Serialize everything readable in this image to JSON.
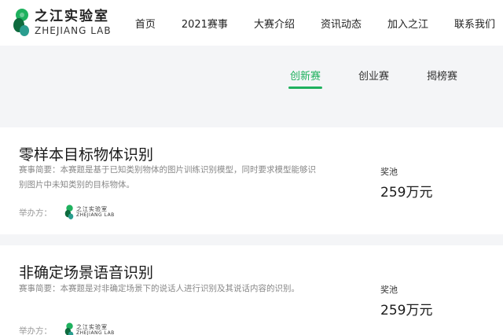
{
  "brand": {
    "name_cn": "之江实验室",
    "name_en": "ZHEJIANG LAB",
    "colors": {
      "green": "#1fb15e",
      "dark_green": "#0e6b3e",
      "teal": "#2a9d8f"
    }
  },
  "nav": {
    "items": [
      {
        "label": "首页"
      },
      {
        "label": "2021赛事"
      },
      {
        "label": "大赛介绍"
      },
      {
        "label": "资讯动态"
      },
      {
        "label": "加入之江"
      },
      {
        "label": "联系我们"
      }
    ]
  },
  "tabs": {
    "items": [
      {
        "label": "创新赛",
        "active": true
      },
      {
        "label": "创业赛",
        "active": false
      },
      {
        "label": "揭榜赛",
        "active": false
      }
    ]
  },
  "competitions": [
    {
      "title": "零样本目标物体识别",
      "description": "赛事简要：本赛题是基于已知类别物体的图片训练识别模型，同时要求模型能够识别图片中未知类别的目标物体。",
      "organizer_label": "举办方：",
      "prize_label": "奖池",
      "prize_value": "259万元"
    },
    {
      "title": "非确定场景语音识别",
      "description": "赛事简要：本赛题是对非确定场景下的说话人进行识别及其说话内容的识别。",
      "organizer_label": "举办方：",
      "prize_label": "奖池",
      "prize_value": "259万元"
    }
  ],
  "organizer_logo": {
    "name_cn": "之江实验室",
    "name_en": "ZHEJIANG LAB"
  }
}
